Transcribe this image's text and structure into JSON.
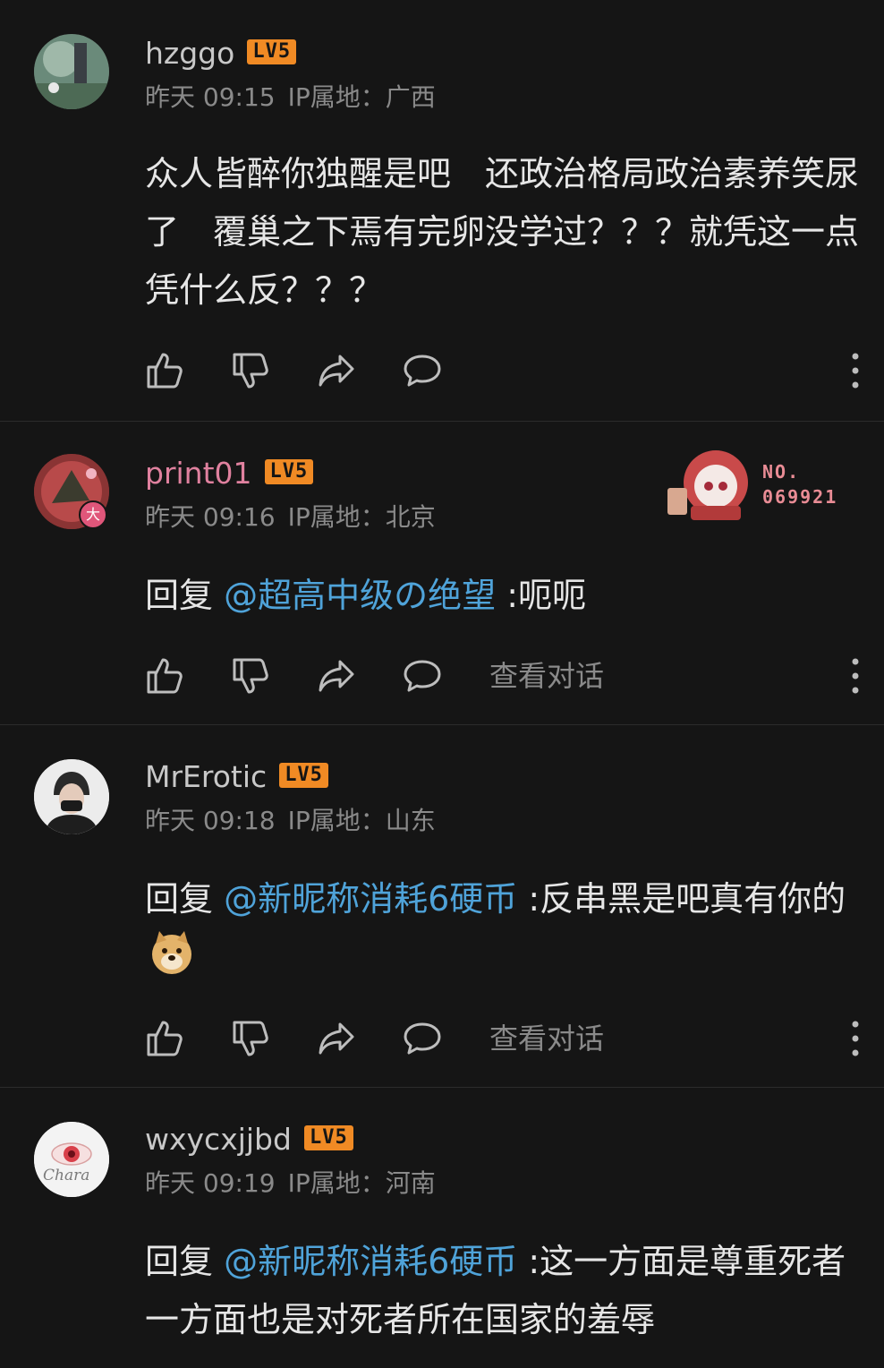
{
  "comments": [
    {
      "username": "hzggo",
      "level": "LV5",
      "time": "昨天 09:15",
      "ip_label": "IP属地：广西",
      "text": "众人皆醉你独醒是吧　还政治格局政治素养笑尿了　覆巢之下焉有完卵没学过？？？就凭这一点凭什么反？？？"
    },
    {
      "username": "print01",
      "level": "LV5",
      "time": "昨天 09:16",
      "ip_label": "IP属地：北京",
      "reply_prefix": "回复 ",
      "mention": "@超高中级の绝望",
      "text": " :呃呃",
      "badge_no": "NO.",
      "badge_num": "069921",
      "avatar_tag": "大",
      "view_conversation": "查看对话"
    },
    {
      "username": "MrErotic",
      "level": "LV5",
      "time": "昨天 09:18",
      "ip_label": "IP属地：山东",
      "reply_prefix": "回复 ",
      "mention": "@新昵称消耗6硬币",
      "text": " :反串黑是吧真有你的",
      "view_conversation": "查看对话"
    },
    {
      "username": "wxycxjjbd",
      "level": "LV5",
      "time": "昨天 09:19",
      "ip_label": "IP属地：河南",
      "reply_prefix": "回复 ",
      "mention": "@新昵称消耗6硬币",
      "text": " :这一方面是尊重死者 一方面也是对死者所在国家的羞辱",
      "avatar_script": "Chara"
    }
  ],
  "icons": {
    "like": "thumbs-up-icon",
    "dislike": "thumbs-down-icon",
    "share": "share-icon",
    "reply": "comment-icon",
    "more": "more-vertical-icon"
  },
  "colors": {
    "background": "#151515",
    "level_badge": "#f08a24",
    "mention": "#4fa3d9",
    "vip_name": "#e0819f",
    "meta": "#8a8a8a"
  }
}
